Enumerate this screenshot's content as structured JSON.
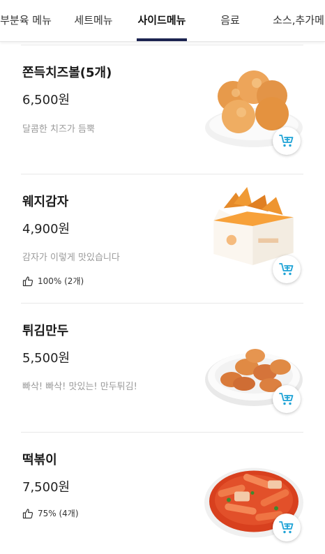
{
  "tabs": [
    {
      "label": "부분육 메뉴"
    },
    {
      "label": "세트메뉴"
    },
    {
      "label": "사이드메뉴"
    },
    {
      "label": "음료"
    },
    {
      "label": "소스,추가메"
    }
  ],
  "items": [
    {
      "name": "쫀득치즈볼(5개)",
      "price": "6,500원",
      "description": "달콤한 치즈가 듬뿍",
      "rating": ""
    },
    {
      "name": "웨지감자",
      "price": "4,900원",
      "description": "감자가 이렇게 맛있습니다",
      "rating": "100% (2개)"
    },
    {
      "name": "튀김만두",
      "price": "5,500원",
      "description": "빠삭! 빠삭! 맛있는! 만두튀김!",
      "rating": ""
    },
    {
      "name": "떡볶이",
      "price": "7,500원",
      "description": "",
      "rating": "75% (4개)"
    }
  ],
  "colors": {
    "accent": "#1b2350",
    "cart": "#1fa3d6",
    "desc": "#9a9a9a"
  },
  "icons": {
    "cart": "cart-add-icon",
    "like": "thumbs-up-icon"
  }
}
